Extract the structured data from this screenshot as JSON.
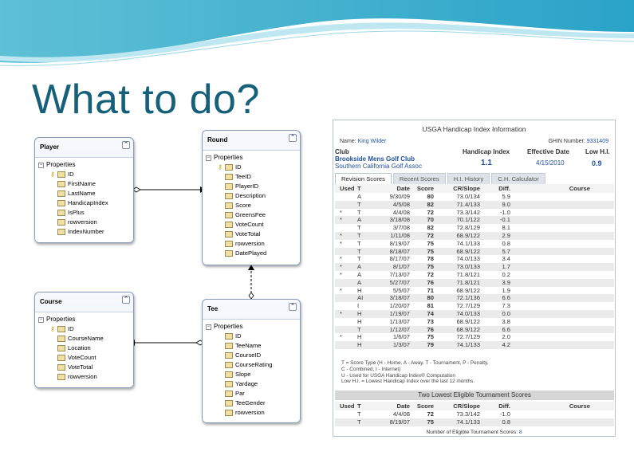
{
  "slide_title": "What to do?",
  "er": {
    "player": {
      "title": "Player",
      "section": "Properties",
      "fields": [
        "ID",
        "FirstName",
        "LastName",
        "HandicapIndex",
        "IsPlus",
        "rowversion",
        "IndexNumber"
      ]
    },
    "round": {
      "title": "Round",
      "section": "Properties",
      "fields": [
        "ID",
        "TeeID",
        "PlayerID",
        "Description",
        "Score",
        "GreensFee",
        "VoteCount",
        "VoteTotal",
        "rowversion",
        "DatePlayed"
      ]
    },
    "course": {
      "title": "Course",
      "section": "Properties",
      "fields": [
        "ID",
        "CourseName",
        "Location",
        "VoteCount",
        "VoteTotal",
        "rowversion"
      ]
    },
    "tee": {
      "title": "Tee",
      "section": "Properties",
      "fields": [
        "ID",
        "TeeName",
        "CourseID",
        "CourseRating",
        "Slope",
        "Yardage",
        "Par",
        "TeeGender",
        "rowversion"
      ]
    },
    "collapse_glyph": "⌃"
  },
  "handicap": {
    "title": "USGA Handicap Index Information",
    "name_label": "Name:",
    "name": "King Wilder",
    "ghin_label": "GHIN Number:",
    "ghin": "9331409",
    "club_label": "Club",
    "club_name": "Brookside Mens Golf Club",
    "club_assoc": "Southern California Golf Assoc",
    "hi_label": "Handicap Index",
    "hi_value": "1.1",
    "ed_label": "Effective Date",
    "ed_value": "4/15/2010",
    "lh_label": "Low H.I.",
    "lh_value": "0.9",
    "tabs": [
      "Revision Scores",
      "Recent Scores",
      "H.I. History",
      "C.H. Calculator"
    ],
    "columns": [
      "Used",
      "T",
      "Date",
      "Score",
      "CR/Slope",
      "Diff.",
      "Course"
    ],
    "rows": [
      [
        "",
        "A",
        "9/30/09",
        "80",
        "73.0/134",
        "5.9"
      ],
      [
        "",
        "T",
        "4/5/08",
        "82",
        "71.4/133",
        "9.0"
      ],
      [
        "*",
        "T",
        "4/4/08",
        "72",
        "73.3/142",
        "-1.0"
      ],
      [
        "*",
        "A",
        "3/18/08",
        "70",
        "70.1/122",
        "-0.1"
      ],
      [
        "",
        "T",
        "3/7/08",
        "82",
        "72.8/129",
        "8.1"
      ],
      [
        "*",
        "T",
        "1/11/08",
        "72",
        "68.9/122",
        "2.9"
      ],
      [
        "*",
        "T",
        "8/19/07",
        "75",
        "74.1/133",
        "0.8"
      ],
      [
        "",
        "T",
        "8/18/07",
        "75",
        "68.9/122",
        "5.7"
      ],
      [
        "*",
        "T",
        "8/17/07",
        "78",
        "74.0/133",
        "3.4"
      ],
      [
        "*",
        "A",
        "8/1/07",
        "75",
        "73.0/133",
        "1.7"
      ],
      [
        "*",
        "A",
        "7/13/07",
        "72",
        "71.8/121",
        "0.2"
      ],
      [
        "",
        "A",
        "5/27/07",
        "76",
        "71.8/121",
        "3.9"
      ],
      [
        "*",
        "H",
        "5/5/07",
        "71",
        "68.9/122",
        "1.9"
      ],
      [
        "",
        "AI",
        "3/18/07",
        "80",
        "72.1/136",
        "6.6"
      ],
      [
        "",
        "I",
        "1/20/07",
        "81",
        "72.7/129",
        "7.3"
      ],
      [
        "*",
        "H",
        "1/19/07",
        "74",
        "74.0/133",
        "0.0"
      ],
      [
        "",
        "H",
        "1/13/07",
        "73",
        "68.9/122",
        "3.8"
      ],
      [
        "",
        "T",
        "1/12/07",
        "76",
        "68.9/122",
        "6.6"
      ],
      [
        "*",
        "H",
        "1/6/07",
        "75",
        "72.7/129",
        "2.0"
      ],
      [
        "",
        "H",
        "1/3/07",
        "79",
        "74.1/133",
        "4.2"
      ]
    ],
    "notes": [
      "T = Score Type (H - Home, A - Away, T - Tournament, P - Penalty,",
      "C - Combined, I - Internet)",
      "U - Used for USGA Handicap Index® Computation",
      "Low H.I. = Lowest Handicap Index over the last 12 months."
    ],
    "tourn_title": "Two Lowest Eligible Tournament Scores",
    "tourn_rows": [
      [
        "",
        "T",
        "4/4/08",
        "72",
        "73.3/142",
        "-1.0"
      ],
      [
        "",
        "T",
        "8/19/07",
        "75",
        "74.1/133",
        "0.8"
      ]
    ],
    "count_label": "Number of Eligible Tournament Scores:",
    "count_value": "8"
  }
}
